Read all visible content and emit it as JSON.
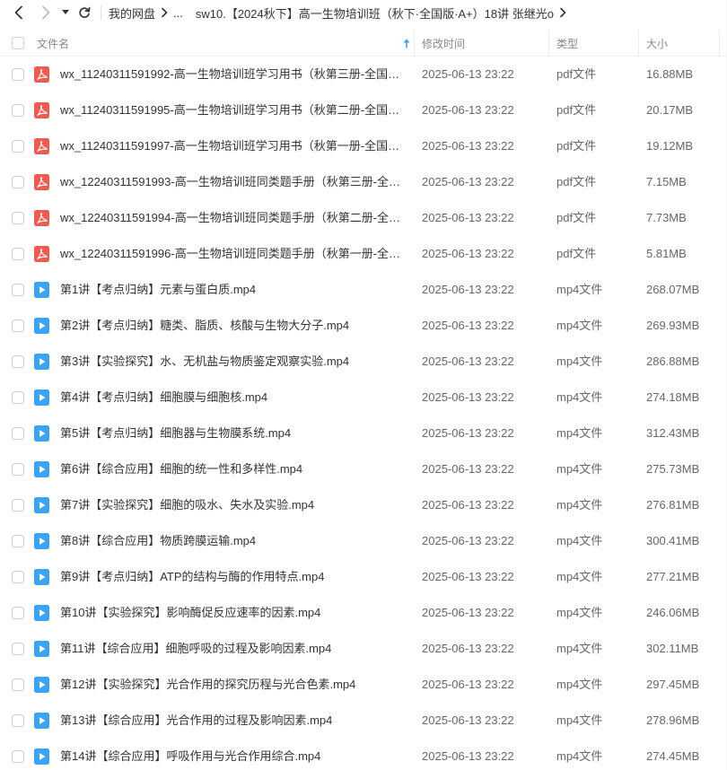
{
  "breadcrumb": {
    "root": "我的网盘",
    "ellipsis": "...",
    "current": "sw10.【2024秋下】高一生物培训班（秋下·全国版·A+）18讲 张继光o"
  },
  "columns": {
    "name": "文件名",
    "time": "修改时间",
    "type": "类型",
    "size": "大小"
  },
  "icons": {
    "pdf_color": "#f15b4e",
    "mp4_color": "#3aa3f5",
    "sort_color": "#3aa3f5"
  },
  "files": [
    {
      "kind": "pdf",
      "name": "wx_11240311591992-高一生物培训班学习用书（秋第三册-全国通用-...",
      "time": "2025-06-13 23:22",
      "type": "pdf文件",
      "size": "16.88MB"
    },
    {
      "kind": "pdf",
      "name": "wx_11240311591995-高一生物培训班学习用书（秋第二册-全国通用-...",
      "time": "2025-06-13 23:22",
      "type": "pdf文件",
      "size": "20.17MB"
    },
    {
      "kind": "pdf",
      "name": "wx_11240311591997-高一生物培训班学习用书（秋第一册-全国通用-...",
      "time": "2025-06-13 23:22",
      "type": "pdf文件",
      "size": "19.12MB"
    },
    {
      "kind": "pdf",
      "name": "wx_12240311591993-高一生物培训班同类题手册（秋第三册-全国通...",
      "time": "2025-06-13 23:22",
      "type": "pdf文件",
      "size": "7.15MB"
    },
    {
      "kind": "pdf",
      "name": "wx_12240311591994-高一生物培训班同类题手册（秋第二册-全国通...",
      "time": "2025-06-13 23:22",
      "type": "pdf文件",
      "size": "7.73MB"
    },
    {
      "kind": "pdf",
      "name": "wx_12240311591996-高一生物培训班同类题手册（秋第一册-全国通...",
      "time": "2025-06-13 23:22",
      "type": "pdf文件",
      "size": "5.81MB"
    },
    {
      "kind": "mp4",
      "name": "第1讲【考点归纳】元素与蛋白质.mp4",
      "time": "2025-06-13 23:22",
      "type": "mp4文件",
      "size": "268.07MB"
    },
    {
      "kind": "mp4",
      "name": "第2讲【考点归纳】糖类、脂质、核酸与生物大分子.mp4",
      "time": "2025-06-13 23:22",
      "type": "mp4文件",
      "size": "269.93MB"
    },
    {
      "kind": "mp4",
      "name": "第3讲【实验探究】水、无机盐与物质鉴定观察实验.mp4",
      "time": "2025-06-13 23:22",
      "type": "mp4文件",
      "size": "286.88MB"
    },
    {
      "kind": "mp4",
      "name": "第4讲【考点归纳】细胞膜与细胞核.mp4",
      "time": "2025-06-13 23:22",
      "type": "mp4文件",
      "size": "274.18MB"
    },
    {
      "kind": "mp4",
      "name": "第5讲【考点归纳】细胞器与生物膜系统.mp4",
      "time": "2025-06-13 23:22",
      "type": "mp4文件",
      "size": "312.43MB"
    },
    {
      "kind": "mp4",
      "name": "第6讲【综合应用】细胞的统一性和多样性.mp4",
      "time": "2025-06-13 23:22",
      "type": "mp4文件",
      "size": "275.73MB"
    },
    {
      "kind": "mp4",
      "name": "第7讲【实验探究】细胞的吸水、失水及实验.mp4",
      "time": "2025-06-13 23:22",
      "type": "mp4文件",
      "size": "276.81MB"
    },
    {
      "kind": "mp4",
      "name": "第8讲【综合应用】物质跨膜运输.mp4",
      "time": "2025-06-13 23:22",
      "type": "mp4文件",
      "size": "300.41MB"
    },
    {
      "kind": "mp4",
      "name": "第9讲【考点归纳】ATP的结构与酶的作用特点.mp4",
      "time": "2025-06-13 23:22",
      "type": "mp4文件",
      "size": "277.21MB"
    },
    {
      "kind": "mp4",
      "name": "第10讲【实验探究】影响酶促反应速率的因素.mp4",
      "time": "2025-06-13 23:22",
      "type": "mp4文件",
      "size": "246.06MB"
    },
    {
      "kind": "mp4",
      "name": "第11讲【综合应用】细胞呼吸的过程及影响因素.mp4",
      "time": "2025-06-13 23:22",
      "type": "mp4文件",
      "size": "302.11MB"
    },
    {
      "kind": "mp4",
      "name": "第12讲【实验探究】光合作用的探究历程与光合色素.mp4",
      "time": "2025-06-13 23:22",
      "type": "mp4文件",
      "size": "297.45MB"
    },
    {
      "kind": "mp4",
      "name": "第13讲【综合应用】光合作用的过程及影响因素.mp4",
      "time": "2025-06-13 23:22",
      "type": "mp4文件",
      "size": "278.96MB"
    },
    {
      "kind": "mp4",
      "name": "第14讲【综合应用】呼吸作用与光合作用综合.mp4",
      "time": "2025-06-13 23:22",
      "type": "mp4文件",
      "size": "274.45MB"
    }
  ]
}
